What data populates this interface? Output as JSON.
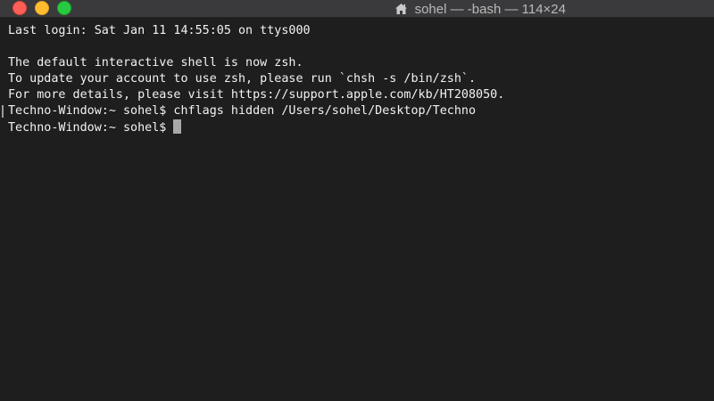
{
  "window": {
    "title": "sohel — -bash — 114×24",
    "title_icon": "home-icon"
  },
  "colors": {
    "background": "#1e1e1e",
    "text": "#f2f2f2",
    "close": "#ff5f57",
    "minimize": "#febc2e",
    "zoom": "#28c840"
  },
  "terminal": {
    "lines": [
      "Last login: Sat Jan 11 14:55:05 on ttys000",
      "",
      "The default interactive shell is now zsh.",
      "To update your account to use zsh, please run `chsh -s /bin/zsh`.",
      "For more details, please visit https://support.apple.com/kb/HT208050.",
      "Techno-Window:~ sohel$ chflags hidden /Users/sohel/Desktop/Techno"
    ],
    "prompt": "Techno-Window:~ sohel$"
  }
}
